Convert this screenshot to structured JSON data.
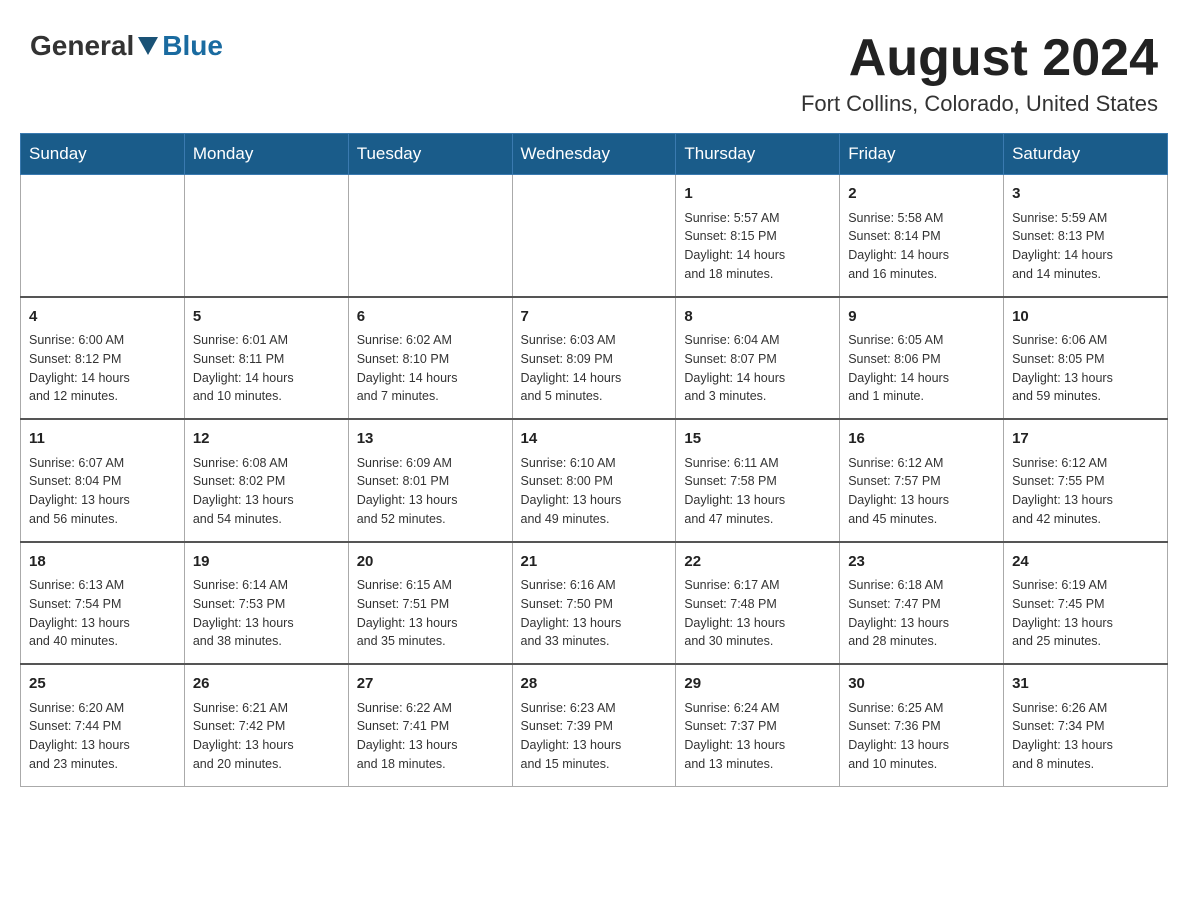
{
  "header": {
    "logo_general": "General",
    "logo_blue": "Blue",
    "month": "August 2024",
    "location": "Fort Collins, Colorado, United States"
  },
  "weekdays": [
    "Sunday",
    "Monday",
    "Tuesday",
    "Wednesday",
    "Thursday",
    "Friday",
    "Saturday"
  ],
  "weeks": [
    [
      {
        "day": "",
        "info": ""
      },
      {
        "day": "",
        "info": ""
      },
      {
        "day": "",
        "info": ""
      },
      {
        "day": "",
        "info": ""
      },
      {
        "day": "1",
        "info": "Sunrise: 5:57 AM\nSunset: 8:15 PM\nDaylight: 14 hours\nand 18 minutes."
      },
      {
        "day": "2",
        "info": "Sunrise: 5:58 AM\nSunset: 8:14 PM\nDaylight: 14 hours\nand 16 minutes."
      },
      {
        "day": "3",
        "info": "Sunrise: 5:59 AM\nSunset: 8:13 PM\nDaylight: 14 hours\nand 14 minutes."
      }
    ],
    [
      {
        "day": "4",
        "info": "Sunrise: 6:00 AM\nSunset: 8:12 PM\nDaylight: 14 hours\nand 12 minutes."
      },
      {
        "day": "5",
        "info": "Sunrise: 6:01 AM\nSunset: 8:11 PM\nDaylight: 14 hours\nand 10 minutes."
      },
      {
        "day": "6",
        "info": "Sunrise: 6:02 AM\nSunset: 8:10 PM\nDaylight: 14 hours\nand 7 minutes."
      },
      {
        "day": "7",
        "info": "Sunrise: 6:03 AM\nSunset: 8:09 PM\nDaylight: 14 hours\nand 5 minutes."
      },
      {
        "day": "8",
        "info": "Sunrise: 6:04 AM\nSunset: 8:07 PM\nDaylight: 14 hours\nand 3 minutes."
      },
      {
        "day": "9",
        "info": "Sunrise: 6:05 AM\nSunset: 8:06 PM\nDaylight: 14 hours\nand 1 minute."
      },
      {
        "day": "10",
        "info": "Sunrise: 6:06 AM\nSunset: 8:05 PM\nDaylight: 13 hours\nand 59 minutes."
      }
    ],
    [
      {
        "day": "11",
        "info": "Sunrise: 6:07 AM\nSunset: 8:04 PM\nDaylight: 13 hours\nand 56 minutes."
      },
      {
        "day": "12",
        "info": "Sunrise: 6:08 AM\nSunset: 8:02 PM\nDaylight: 13 hours\nand 54 minutes."
      },
      {
        "day": "13",
        "info": "Sunrise: 6:09 AM\nSunset: 8:01 PM\nDaylight: 13 hours\nand 52 minutes."
      },
      {
        "day": "14",
        "info": "Sunrise: 6:10 AM\nSunset: 8:00 PM\nDaylight: 13 hours\nand 49 minutes."
      },
      {
        "day": "15",
        "info": "Sunrise: 6:11 AM\nSunset: 7:58 PM\nDaylight: 13 hours\nand 47 minutes."
      },
      {
        "day": "16",
        "info": "Sunrise: 6:12 AM\nSunset: 7:57 PM\nDaylight: 13 hours\nand 45 minutes."
      },
      {
        "day": "17",
        "info": "Sunrise: 6:12 AM\nSunset: 7:55 PM\nDaylight: 13 hours\nand 42 minutes."
      }
    ],
    [
      {
        "day": "18",
        "info": "Sunrise: 6:13 AM\nSunset: 7:54 PM\nDaylight: 13 hours\nand 40 minutes."
      },
      {
        "day": "19",
        "info": "Sunrise: 6:14 AM\nSunset: 7:53 PM\nDaylight: 13 hours\nand 38 minutes."
      },
      {
        "day": "20",
        "info": "Sunrise: 6:15 AM\nSunset: 7:51 PM\nDaylight: 13 hours\nand 35 minutes."
      },
      {
        "day": "21",
        "info": "Sunrise: 6:16 AM\nSunset: 7:50 PM\nDaylight: 13 hours\nand 33 minutes."
      },
      {
        "day": "22",
        "info": "Sunrise: 6:17 AM\nSunset: 7:48 PM\nDaylight: 13 hours\nand 30 minutes."
      },
      {
        "day": "23",
        "info": "Sunrise: 6:18 AM\nSunset: 7:47 PM\nDaylight: 13 hours\nand 28 minutes."
      },
      {
        "day": "24",
        "info": "Sunrise: 6:19 AM\nSunset: 7:45 PM\nDaylight: 13 hours\nand 25 minutes."
      }
    ],
    [
      {
        "day": "25",
        "info": "Sunrise: 6:20 AM\nSunset: 7:44 PM\nDaylight: 13 hours\nand 23 minutes."
      },
      {
        "day": "26",
        "info": "Sunrise: 6:21 AM\nSunset: 7:42 PM\nDaylight: 13 hours\nand 20 minutes."
      },
      {
        "day": "27",
        "info": "Sunrise: 6:22 AM\nSunset: 7:41 PM\nDaylight: 13 hours\nand 18 minutes."
      },
      {
        "day": "28",
        "info": "Sunrise: 6:23 AM\nSunset: 7:39 PM\nDaylight: 13 hours\nand 15 minutes."
      },
      {
        "day": "29",
        "info": "Sunrise: 6:24 AM\nSunset: 7:37 PM\nDaylight: 13 hours\nand 13 minutes."
      },
      {
        "day": "30",
        "info": "Sunrise: 6:25 AM\nSunset: 7:36 PM\nDaylight: 13 hours\nand 10 minutes."
      },
      {
        "day": "31",
        "info": "Sunrise: 6:26 AM\nSunset: 7:34 PM\nDaylight: 13 hours\nand 8 minutes."
      }
    ]
  ]
}
